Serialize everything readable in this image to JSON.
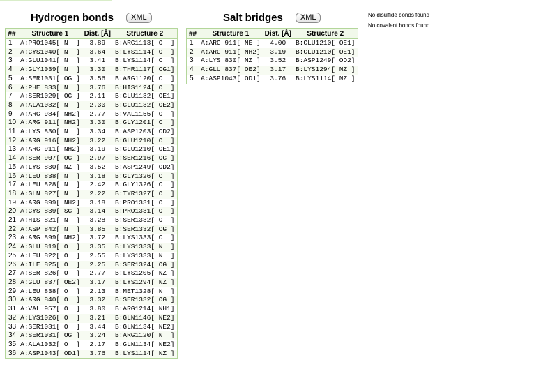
{
  "hydrogen_bonds": {
    "title": "Hydrogen bonds",
    "xml_label": "XML",
    "columns": [
      "##",
      "Structure 1",
      "Dist. [Å]",
      "Structure 2"
    ],
    "rows": [
      [
        "1",
        "A:PRO1045[ N  ]",
        "3.89",
        "B:ARG1113[ O  ]"
      ],
      [
        "2",
        "A:CYS1040[ N  ]",
        "3.64",
        "B:LYS1114[ O  ]"
      ],
      [
        "3",
        "A:GLU1041[ N  ]",
        "3.41",
        "B:LYS1114[ O  ]"
      ],
      [
        "4",
        "A:GLY1039[ N  ]",
        "3.30",
        "B:THR1117[ OG1]"
      ],
      [
        "5",
        "A:SER1031[ OG ]",
        "3.56",
        "B:ARG1120[ O  ]"
      ],
      [
        "6",
        "A:PHE 833[ N  ]",
        "3.76",
        "B:HIS1124[ O  ]"
      ],
      [
        "7",
        "A:SER1029[ OG ]",
        "2.11",
        "B:GLU1132[ OE1]"
      ],
      [
        "8",
        "A:ALA1032[ N  ]",
        "2.30",
        "B:GLU1132[ OE2]"
      ],
      [
        "9",
        "A:ARG 984[ NH2]",
        "2.77",
        "B:VAL1155[ O  ]"
      ],
      [
        "10",
        "A:ARG 911[ NH2]",
        "3.30",
        "B:GLY1201[ O  ]"
      ],
      [
        "11",
        "A:LYS 830[ N  ]",
        "3.34",
        "B:ASP1203[ OD2]"
      ],
      [
        "12",
        "A:ARG 916[ NH2]",
        "3.22",
        "B:GLU1210[ O  ]"
      ],
      [
        "13",
        "A:ARG 911[ NH2]",
        "3.19",
        "B:GLU1210[ OE1]"
      ],
      [
        "14",
        "A:SER 907[ OG ]",
        "2.97",
        "B:SER1216[ OG ]"
      ],
      [
        "15",
        "A:LYS 830[ NZ ]",
        "3.52",
        "B:ASP1249[ OD2]"
      ],
      [
        "16",
        "A:LEU 838[ N  ]",
        "3.18",
        "B:GLY1326[ O  ]"
      ],
      [
        "17",
        "A:LEU 828[ N  ]",
        "2.42",
        "B:GLY1326[ O  ]"
      ],
      [
        "18",
        "A:GLN 827[ N  ]",
        "2.22",
        "B:TYR1327[ O  ]"
      ],
      [
        "19",
        "A:ARG 899[ NH2]",
        "3.18",
        "B:PRO1331[ O  ]"
      ],
      [
        "20",
        "A:CYS 839[ SG ]",
        "3.14",
        "B:PRO1331[ O  ]"
      ],
      [
        "21",
        "A:HIS 821[ N  ]",
        "3.28",
        "B:SER1332[ O  ]"
      ],
      [
        "22",
        "A:ASP 842[ N  ]",
        "3.85",
        "B:SER1332[ OG ]"
      ],
      [
        "23",
        "A:ARG 899[ NH2]",
        "3.72",
        "B:LYS1333[ O  ]"
      ],
      [
        "24",
        "A:GLU 819[ O  ]",
        "3.35",
        "B:LYS1333[ N  ]"
      ],
      [
        "25",
        "A:LEU 822[ O  ]",
        "2.55",
        "B:LYS1333[ N  ]"
      ],
      [
        "26",
        "A:ILE 825[ O  ]",
        "2.25",
        "B:SER1324[ OG ]"
      ],
      [
        "27",
        "A:SER 826[ O  ]",
        "2.77",
        "B:LYS1205[ NZ ]"
      ],
      [
        "28",
        "A:GLU 837[ OE2]",
        "3.17",
        "B:LYS1294[ NZ ]"
      ],
      [
        "29",
        "A:LEU 838[ O  ]",
        "2.13",
        "B:MET1328[ N  ]"
      ],
      [
        "30",
        "A:ARG 840[ O  ]",
        "3.32",
        "B:SER1332[ OG ]"
      ],
      [
        "31",
        "A:VAL 957[ O  ]",
        "3.80",
        "B:ARG1214[ NH1]"
      ],
      [
        "32",
        "A:LYS1026[ O  ]",
        "3.21",
        "B:GLN1146[ NE2]"
      ],
      [
        "33",
        "A:SER1031[ O  ]",
        "3.44",
        "B:GLN1134[ NE2]"
      ],
      [
        "34",
        "A:SER1031[ OG ]",
        "3.24",
        "B:ARG1120[ N  ]"
      ],
      [
        "35",
        "A:ALA1032[ O  ]",
        "2.17",
        "B:GLN1134[ NE2]"
      ],
      [
        "36",
        "A:ASP1043[ OD1]",
        "3.76",
        "B:LYS1114[ NZ ]"
      ]
    ]
  },
  "salt_bridges": {
    "title": "Salt bridges",
    "xml_label": "XML",
    "columns": [
      "##",
      "Structure 1",
      "Dist. [Å]",
      "Structure 2"
    ],
    "rows": [
      [
        "1",
        "A:ARG 911[ NE ]",
        "4.00",
        "B:GLU1210[ OE1]"
      ],
      [
        "2",
        "A:ARG 911[ NH2]",
        "3.19",
        "B:GLU1210[ OE1]"
      ],
      [
        "3",
        "A:LYS 830[ NZ ]",
        "3.52",
        "B:ASP1249[ OD2]"
      ],
      [
        "4",
        "A:GLU 837[ OE2]",
        "3.17",
        "B:LYS1294[ NZ ]"
      ],
      [
        "5",
        "A:ASP1043[ OD1]",
        "3.76",
        "B:LYS1114[ NZ ]"
      ]
    ]
  },
  "notes": {
    "disulfide": "No disulfide bonds found",
    "covalent": "No covalent bonds found"
  }
}
